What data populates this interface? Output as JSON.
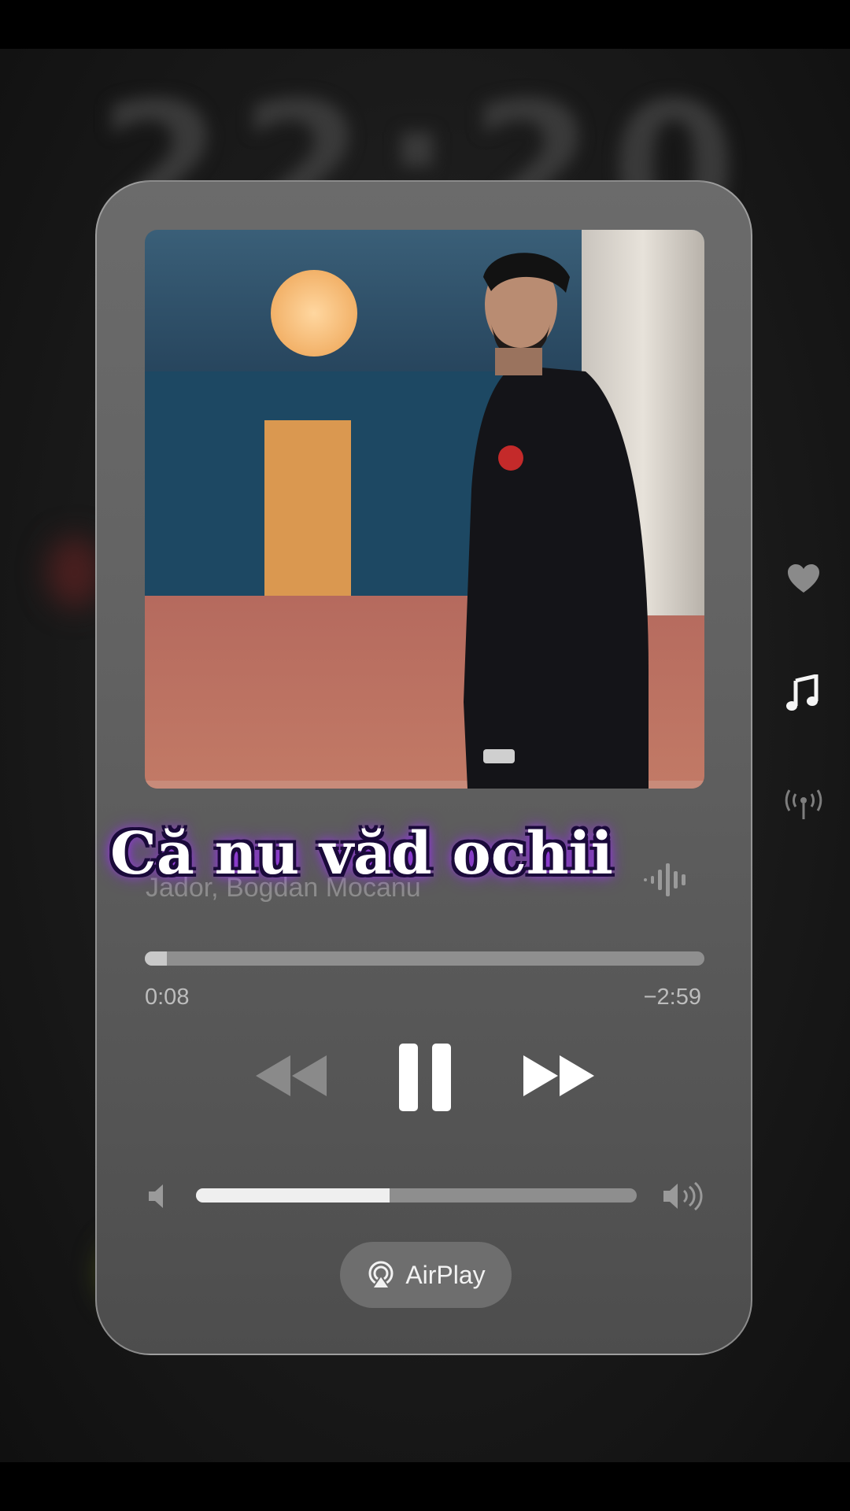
{
  "background": {
    "clock_text": "22:20"
  },
  "player": {
    "track_title": "",
    "artist": "Jador, Bogdan Mocanu",
    "elapsed": "0:08",
    "remaining": "−2:59",
    "progress_fraction": 0.04,
    "volume_fraction": 0.44,
    "airplay_label": "AirPlay"
  },
  "lyric_overlay": {
    "text": "Că nu văd ochii"
  },
  "side_icons": [
    "heart-icon",
    "music-note-icon",
    "broadcast-icon"
  ],
  "colors": {
    "lyric_glow": "#b23cff",
    "card": "#626262"
  }
}
